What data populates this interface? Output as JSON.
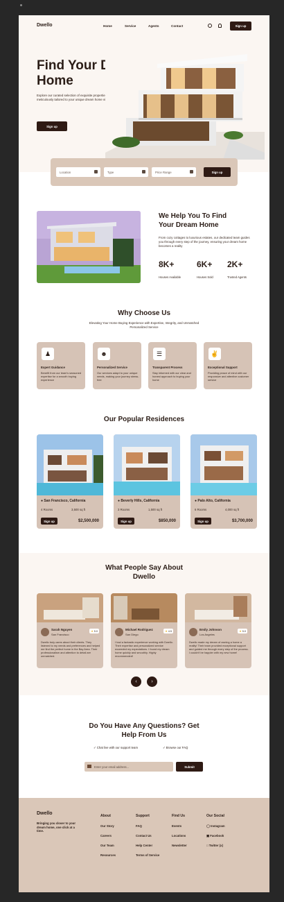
{
  "brand": "Dwello",
  "nav": {
    "items": [
      "Home",
      "Service",
      "Agents",
      "Contact"
    ],
    "signup": "Sign up"
  },
  "hero": {
    "title": "Find Your Dream Home",
    "subtitle": "Explore our curated selection of exquisite properties meticulously tailored to your unique dream home vision",
    "cta": "Sign up"
  },
  "search": {
    "location": "Location",
    "type": "Type",
    "price": "Price Range",
    "cta": "Sign up"
  },
  "about": {
    "title": "We Help You To Find Your Dream Home",
    "text": "From cozy cottages to luxurious estates, our dedicated team guides you through every step of the journey, ensuring your dream home becomes a reality",
    "stats": [
      {
        "value": "8K+",
        "label": "Houses Available"
      },
      {
        "value": "6K+",
        "label": "Houses Sold"
      },
      {
        "value": "2K+",
        "label": "Trusted Agents"
      }
    ]
  },
  "why": {
    "title": "Why Choose Us",
    "subtitle": "Elevating Your Home Buying Experience with Expertise, Integrity, and Unmatched Personalized Service",
    "cards": [
      {
        "icon": "expert-icon",
        "title": "Expert Guidance",
        "text": "Benefit from our team's seasoned expertise for a smooth buying experience"
      },
      {
        "icon": "person-icon",
        "title": "Personalized Service",
        "text": "Our services adapt to your unique needs, making your journey stress-free"
      },
      {
        "icon": "clipboard-icon",
        "title": "Transparent Process",
        "text": "Stay informed with our clear and honest approach to buying your home"
      },
      {
        "icon": "handshake-icon",
        "title": "Exceptional Support",
        "text": "Providing peace of mind with our responsive and attentive customer service"
      }
    ]
  },
  "residences": {
    "title": "Our Popular Residences",
    "items": [
      {
        "location": "San Francisco, California",
        "rooms": "4 Rooms",
        "area": "3,500 sq ft",
        "price": "$2,500,000",
        "cta": "Sign up"
      },
      {
        "location": "Beverly Hills, California",
        "rooms": "3 Rooms",
        "area": "1,500 sq ft",
        "price": "$850,000",
        "cta": "Sign up"
      },
      {
        "location": "Palo Alto, California",
        "rooms": "6 Rooms",
        "area": "4,000 sq ft",
        "price": "$3,700,000",
        "cta": "Sign up"
      }
    ]
  },
  "testimonials": {
    "title": "What People Say About Dwello",
    "items": [
      {
        "name": "Sarah Nguyen",
        "city": "San Francisco",
        "rating": "5.0",
        "text": "Dwello truly cares about their clients. They listened to my needs and preferences and helped me find the perfect home in the Bay Area. Their professionalism and attention to detail are unmatched."
      },
      {
        "name": "Michael Rodriguez",
        "city": "San Diego",
        "rating": "4.5",
        "text": "I had a fantastic experience working with Dwello. Their expertise and personalized service exceeded my expectations. I found my dream home quickly and smoothly. Highly recommended!"
      },
      {
        "name": "Emily Johnson",
        "city": "Los Angeles",
        "rating": "5.0",
        "text": "Dwello made my dream of owning a home a reality! Their team provided exceptional support and guided me through every step of the process. I couldn't be happier with my new home!"
      }
    ]
  },
  "faq": {
    "title": "Do You Have Any Questions? Get Help From Us",
    "chat": "Chat live with our support team",
    "browse": "Browse our FAQ",
    "placeholder": "Enter your email address...",
    "submit": "Submit"
  },
  "footer": {
    "tagline": "Bringing you closer to your dream home, one click at a time.",
    "about": {
      "title": "About",
      "links": [
        "Our Story",
        "Careers",
        "Our Team",
        "Resources"
      ]
    },
    "support": {
      "title": "Support",
      "links": [
        "FAQ",
        "Contact Us",
        "Help Center",
        "Terms of Service"
      ]
    },
    "findus": {
      "title": "Find Us",
      "links": [
        "Events",
        "Locations",
        "Newsletter"
      ]
    },
    "social": {
      "title": "Our Social",
      "links": [
        "Instagram",
        "Facebook",
        "Twitter (x)"
      ]
    }
  },
  "colors": {
    "accent": "#2e1a14",
    "tan": "#d6c3b6",
    "cream": "#fbf6f2"
  }
}
